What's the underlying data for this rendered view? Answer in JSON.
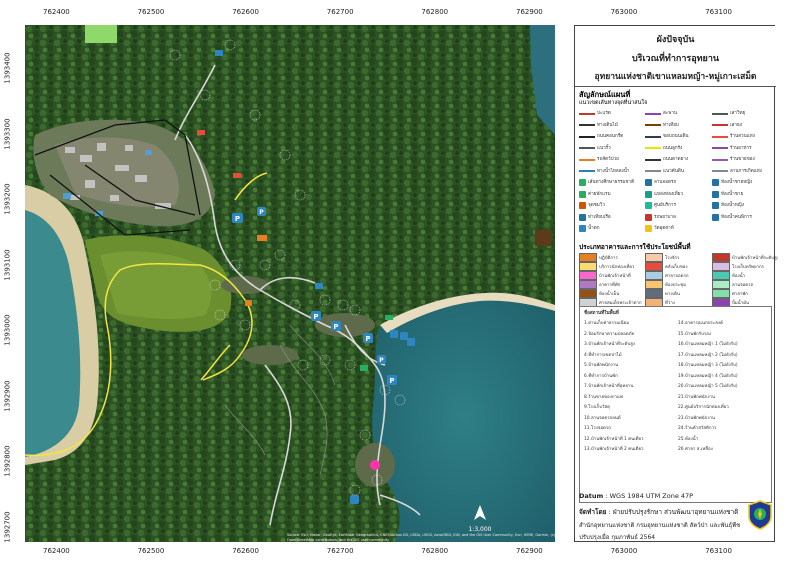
{
  "grid": {
    "x_labels": [
      "762400",
      "762500",
      "762600",
      "762700",
      "762800",
      "762900",
      "763000",
      "763100",
      "763200"
    ],
    "y_labels": [
      "1393400",
      "1393300",
      "1393200",
      "1393100",
      "1393000",
      "1392900",
      "1392800",
      "1392700"
    ]
  },
  "legend": {
    "title_lines": [
      "ผังปัจจุบัน",
      "บริเวณที่ทำการอุทยาน",
      "อุทยานแห่งชาติเขาแหลมหญ้า-หมู่เกาะเสม็ด"
    ],
    "symbols_heading": "สัญลักษณ์แผนที่",
    "symbols_subheading": "แนวเขตเส้นทางจุดที่น่าสนใจ",
    "symbol_items": [
      {
        "label": "ปะแรต",
        "color": "#c0392b"
      },
      {
        "label": "สะพาน",
        "color": "#8e44ad"
      },
      {
        "label": "เสาวิทยุ",
        "color": "#555555"
      },
      {
        "label": "ทางเดินไม้",
        "color": "#333333"
      },
      {
        "label": "ท่าเทียบ",
        "color": "#7b3f00"
      },
      {
        "label": "เสาธง",
        "color": "#c0392b"
      },
      {
        "label": "ถนนคอนกรีต",
        "color": "#222222"
      },
      {
        "label": "ขอบถนนเดิน",
        "color": "#2c3e50"
      },
      {
        "label": "ร้านสวนแห่ง",
        "color": "#e74c3c"
      },
      {
        "label": "แนวรั้ว",
        "color": "#555555"
      },
      {
        "label": "ถนนลูกรัง",
        "color": "#e6e600"
      },
      {
        "label": "ร้านอาหาร",
        "color": "#8e44ad"
      },
      {
        "label": "รถสัตว์ป่วย",
        "color": "#e67e22"
      },
      {
        "label": "ถนนดาดยาง",
        "color": "#333333"
      },
      {
        "label": "ร้านขายของ",
        "color": "#9b59b6"
      },
      {
        "label": "ทางน้ำไหลลงน้ำ",
        "color": "#2980b9"
      },
      {
        "label": "แนวคันดิน",
        "color": "#888888"
      },
      {
        "label": "ลานการเกิดแห่ง",
        "color": "#7f8c8d"
      },
      {
        "label": "เส้นทางศึกษาธรรมชาติ",
        "color": "#27ae60"
      },
      {
        "label": "ลานจอดรถ",
        "color": "#2471a3"
      },
      {
        "label": "ห้องน้ำชายหญิง",
        "color": "#2471a3"
      },
      {
        "label": "ค่ายพักแรม",
        "color": "#27ae60"
      },
      {
        "label": "แหล่งท่องเที่ยว",
        "color": "#16a085"
      },
      {
        "label": "ห้องน้ำชาย",
        "color": "#2471a3"
      },
      {
        "label": "จุดชมวิว",
        "color": "#d35400"
      },
      {
        "label": "ศูนย์บริการ",
        "color": "#1abc9c"
      },
      {
        "label": "ห้องน้ำหญิง",
        "color": "#2471a3"
      },
      {
        "label": "ท่าเทียบเรือ",
        "color": "#2471a3"
      },
      {
        "label": "รถพยาบาล",
        "color": "#c0392b"
      },
      {
        "label": "ห้องน้ำคนพิการ",
        "color": "#2471a3"
      },
      {
        "label": "น้ำตก",
        "color": "#2e86c1"
      },
      {
        "label": "วัดอุตสาห์",
        "color": "#f1c40f"
      }
    ],
    "landuse_heading": "ประเภทอาคารและการใช้ประโยชน์พื้นที่",
    "landuse_items": [
      {
        "label": "ปฏิบัติการ",
        "color": "#e67e22"
      },
      {
        "label": "โรงจักร",
        "color": "#f5cba7"
      },
      {
        "label": "บ้านพักเจ้าหน้าที่ระดับสูงและเพื่อนอาศัย",
        "color": "#c0392b"
      },
      {
        "label": "บริการนักท่องเที่ยว",
        "color": "#f7dc6f"
      },
      {
        "label": "คลังเก็บของ",
        "color": "#e74c3c"
      },
      {
        "label": "โรงเก็บทรัพยากร",
        "color": "#d7bde2"
      },
      {
        "label": "บ้านพักเจ้าหน้าที่",
        "color": "#ff66cc"
      },
      {
        "label": "ศาลาจอดรถ",
        "color": "#a9cce3"
      },
      {
        "label": "ห้องน้ำ",
        "color": "#48c9b0"
      },
      {
        "label": "อาคารที่พัก",
        "color": "#af7ac5"
      },
      {
        "label": "ห้องประชุม",
        "color": "#f8c471"
      },
      {
        "label": "ลานจอดรถ",
        "color": "#abebc6"
      },
      {
        "label": "ห้องน้ำเย็น",
        "color": "#935116"
      },
      {
        "label": "ทางเดิน",
        "color": "#5d6d7e"
      },
      {
        "label": "ศาลาพัก",
        "color": "#82e0aa"
      },
      {
        "label": "ศาลสมเด็จพระเจ้าตาก",
        "color": "#d0d3d4"
      },
      {
        "label": "ที่ว่าง",
        "color": "#f0b27a"
      },
      {
        "label": "ปั้มน้ำมัน",
        "color": "#8e44ad"
      }
    ],
    "places_heading": "ชื่อสถานที่ในพื้นที่",
    "places_left": [
      "1.ด่านเก็บค่าธรรมเนียม",
      "2.ป้อมรักษาความปลอดภัย",
      "3.บ้านพักเจ้าหน้าที่ระดับสูง",
      "4.ที่ทำการเขตป่าไม้",
      "5.บ้านพักพนักงาน",
      "6.ที่ทำการบ้านพัก",
      "7.บ้านพักเจ้าหน้าที่อุทยาน",
      "8.ร้านขายของกาแฟ",
      "9.โรงเก็บวัสดุ",
      "10.ลานจอดรถยนต์",
      "11.โรงจอดรถ",
      "12.บ้านพักเจ้าหน้าที่ 1 คนเดียว",
      "13.บ้านพักเจ้าหน้าที่ 2 คนเดียว"
    ],
    "places_right": [
      "14.อาคารอเนกประสงค์",
      "15.บ้านพักรับรอง",
      "16.บ้านแหลมหญ้า 1 (ไม่ยังรับ)",
      "17.บ้านแหลมหญ้า 2 (ไม่ยังรับ)",
      "18.บ้านแหลมหญ้า 3 (ไม่ยังรับ)",
      "19.บ้านแหลมหญ้า 4 (ไม่ยังรับ)",
      "20.บ้านแหลมหญ้า 5 (ไม่ยังรับ)",
      "21.บ้านพักพนักงาน",
      "22.ศูนย์บริการนักท่องเที่ยว",
      "23.บ้านพักพนักงาน",
      "24.ร้านค้าสวัสดิการ",
      "25.ห้องน้ำ",
      "26.ศาลา ส.เหลือง"
    ],
    "datum_label": "Datum",
    "datum_value": "WGS 1984 UTM Zone 47P",
    "made_by_label": "จัดทำโดย",
    "made_by_line1": "ฝ่ายปรับปรุงรักษา ส่วนพัฒนาอุทยานแห่งชาติ",
    "made_by_line2": "สำนักอุทยานแห่งชาติ กรมอุทยานแห่งชาติ สัตว์ป่า และพันธุ์พืช",
    "updated": "ปรับปรุงเมื่อ กุมภาพันธ์ 2564"
  },
  "map": {
    "scale_label": "1:3,000",
    "credit": "Source: Esri, Maxar, GeoEye, Earthstar Geographics, CNES/Airbus DS, USDA, USGS, AeroGRID, IGN, and the GIS User Community, Esri, HERE, Garmin, (c) OpenStreetMap contributors, and the GIS user community",
    "colors": {
      "forest": "#2f5727",
      "sea": "#3b8a86",
      "beach": "#e8dcc0",
      "road_yellow": "#f4e542",
      "road_white": "#e8e8e8"
    }
  }
}
